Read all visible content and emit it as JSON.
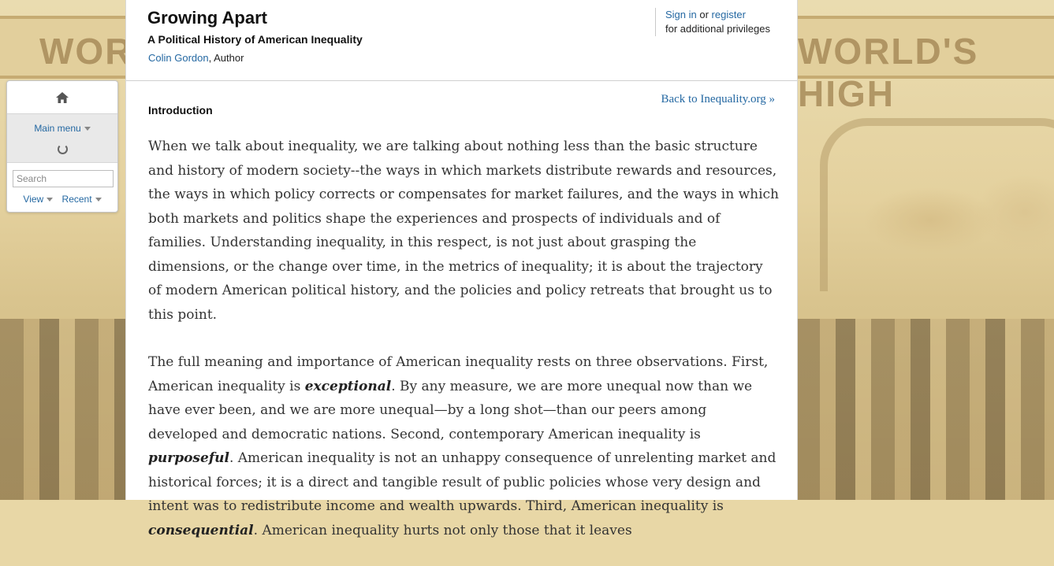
{
  "background": {
    "banner_left": "WOR",
    "banner_right": "WORLD'S HIGH"
  },
  "header": {
    "title": "Growing Apart",
    "subtitle": "A Political History of American Inequality",
    "author_name": "Colin Gordon",
    "author_role": ", Author",
    "sign_in": "Sign in",
    "or": " or ",
    "register": "register",
    "privileges": "for additional privileges"
  },
  "nav": {
    "home_icon": "home-icon",
    "main_menu": "Main menu",
    "search_placeholder": "Search",
    "view": "View",
    "recent": "Recent"
  },
  "article": {
    "back_link": "Back to Inequality.org »",
    "section_title": "Introduction",
    "p1": "When we talk about inequality, we are talking about nothing less than the basic structure and history of modern society--the ways in which markets distribute rewards and resources, the ways in which policy corrects or compensates for market failures, and the ways in which both markets and politics shape the experiences and prospects of individuals and of families. Understanding inequality, in this respect, is not just about grasping the dimensions, or the change over time, in the metrics of inequality; it is about the trajectory of modern American political history, and the policies and policy retreats that brought us to this point.",
    "p2_a": "The full meaning and importance of American inequality rests on three observations. First, American inequality is ",
    "p2_em1": "exceptional",
    "p2_b": ". By any measure, we are more unequal now than we have ever been, and we are more unequal—by a long shot—than our peers among developed and democratic nations.  Second, contemporary American inequality is ",
    "p2_em2": "purposeful",
    "p2_c": ". American inequality is not an unhappy consequence of unrelenting market and historical forces; it is a direct and tangible result of public policies whose very design and intent was to redistribute income and wealth upwards. Third, American inequality is ",
    "p2_em3": "consequential",
    "p2_d": ". American inequality hurts not only those that it leaves"
  }
}
